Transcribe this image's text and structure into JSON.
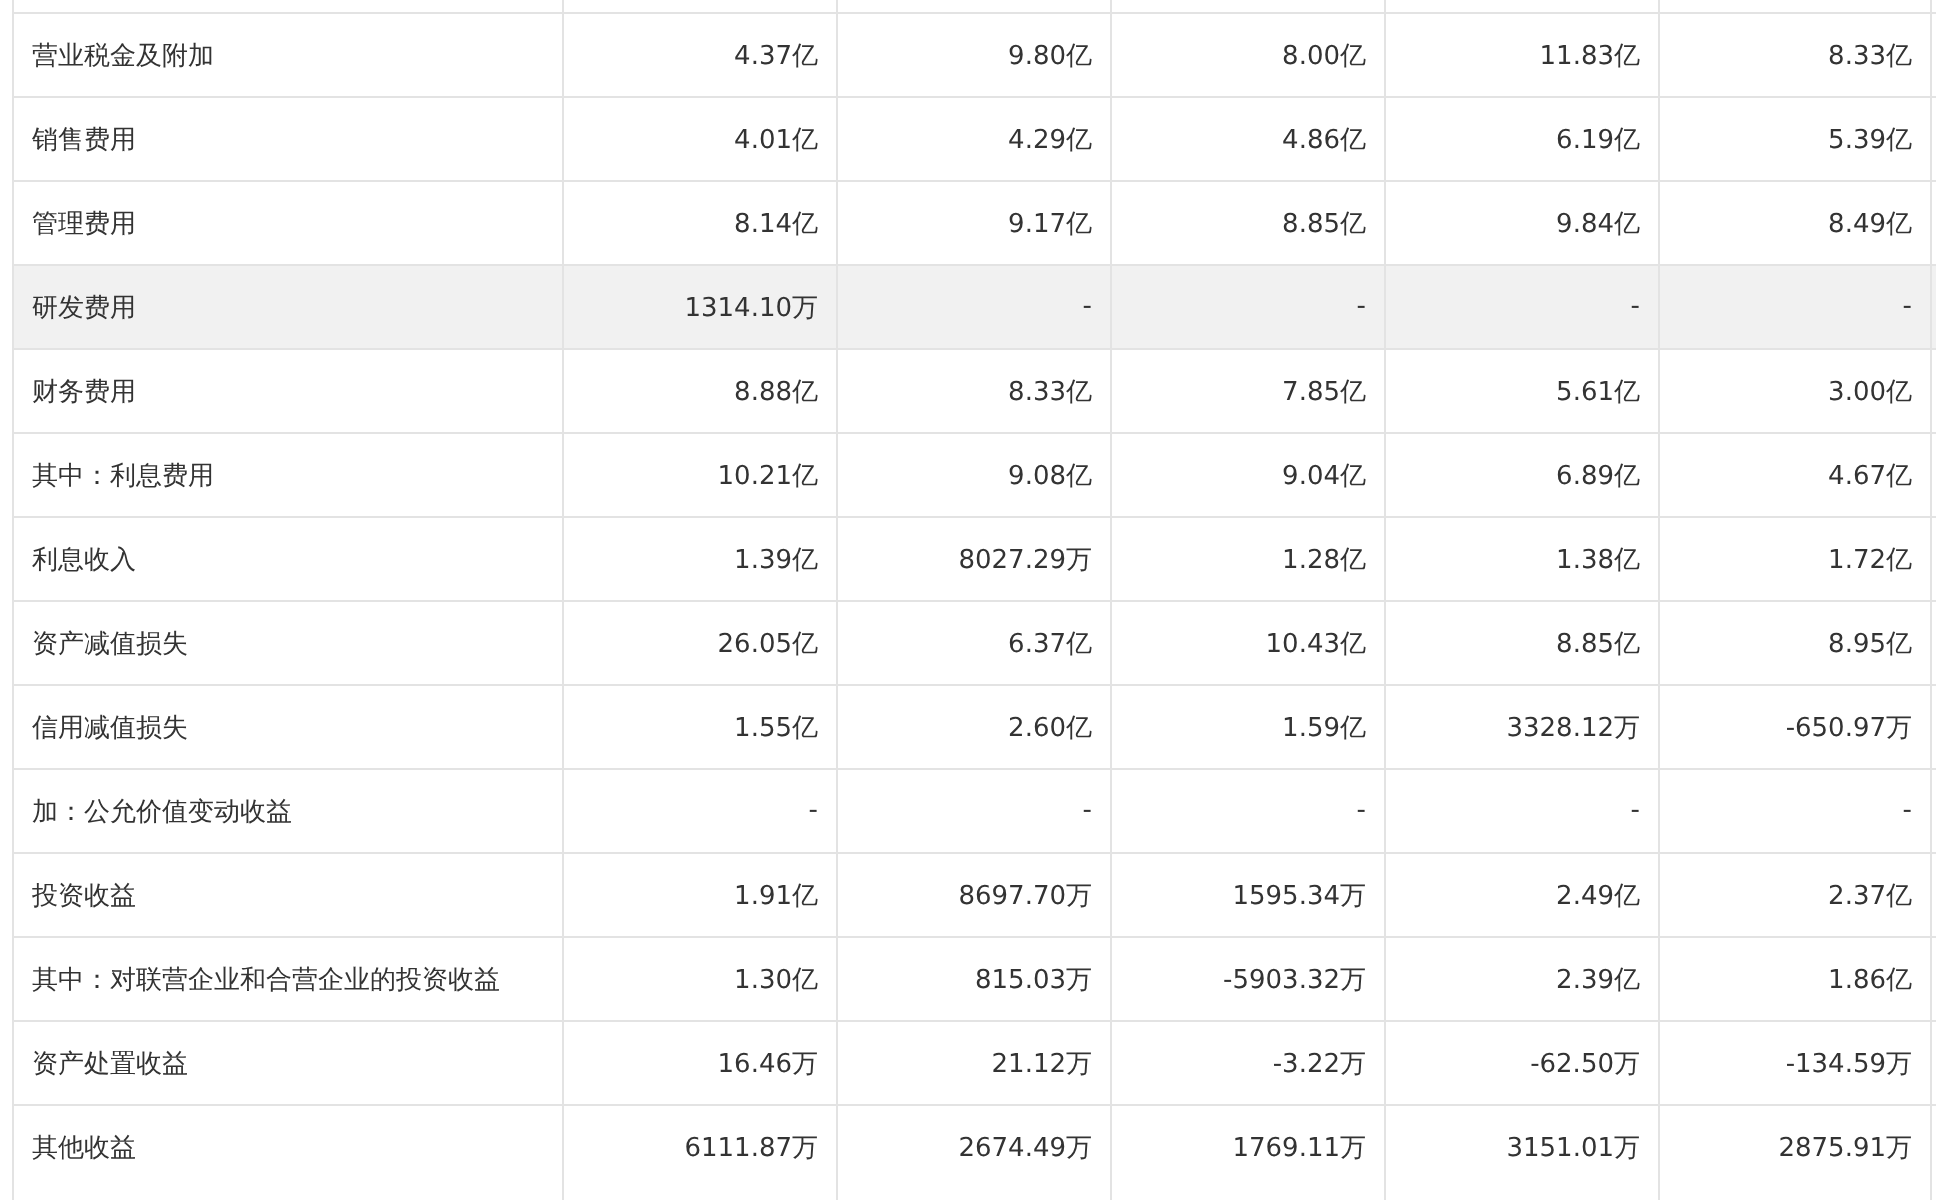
{
  "table": {
    "rows": [
      {
        "label": "营业税金及附加",
        "highlighted": false,
        "values": [
          "4.37亿",
          "9.80亿",
          "8.00亿",
          "11.83亿",
          "8.33亿"
        ]
      },
      {
        "label": "销售费用",
        "highlighted": false,
        "values": [
          "4.01亿",
          "4.29亿",
          "4.86亿",
          "6.19亿",
          "5.39亿"
        ]
      },
      {
        "label": "管理费用",
        "highlighted": false,
        "values": [
          "8.14亿",
          "9.17亿",
          "8.85亿",
          "9.84亿",
          "8.49亿"
        ]
      },
      {
        "label": "研发费用",
        "highlighted": true,
        "values": [
          "1314.10万",
          "-",
          "-",
          "-",
          "-"
        ]
      },
      {
        "label": "财务费用",
        "highlighted": false,
        "values": [
          "8.88亿",
          "8.33亿",
          "7.85亿",
          "5.61亿",
          "3.00亿"
        ]
      },
      {
        "label": "其中：利息费用",
        "highlighted": false,
        "values": [
          "10.21亿",
          "9.08亿",
          "9.04亿",
          "6.89亿",
          "4.67亿"
        ]
      },
      {
        "label": "利息收入",
        "highlighted": false,
        "values": [
          "1.39亿",
          "8027.29万",
          "1.28亿",
          "1.38亿",
          "1.72亿"
        ]
      },
      {
        "label": "资产减值损失",
        "highlighted": false,
        "values": [
          "26.05亿",
          "6.37亿",
          "10.43亿",
          "8.85亿",
          "8.95亿"
        ]
      },
      {
        "label": "信用减值损失",
        "highlighted": false,
        "values": [
          "1.55亿",
          "2.60亿",
          "1.59亿",
          "3328.12万",
          "-650.97万"
        ]
      },
      {
        "label": "加：公允价值变动收益",
        "highlighted": false,
        "values": [
          "-",
          "-",
          "-",
          "-",
          "-"
        ]
      },
      {
        "label": "投资收益",
        "highlighted": false,
        "values": [
          "1.91亿",
          "8697.70万",
          "1595.34万",
          "2.49亿",
          "2.37亿"
        ]
      },
      {
        "label": "其中：对联营企业和合营企业的投资收益",
        "highlighted": false,
        "values": [
          "1.30亿",
          "815.03万",
          "-5903.32万",
          "2.39亿",
          "1.86亿"
        ]
      },
      {
        "label": "资产处置收益",
        "highlighted": false,
        "values": [
          "16.46万",
          "21.12万",
          "-3.22万",
          "-62.50万",
          "-134.59万"
        ]
      },
      {
        "label": "其他收益",
        "highlighted": false,
        "values": [
          "6111.87万",
          "2674.49万",
          "1769.11万",
          "3151.01万",
          "2875.91万"
        ]
      }
    ]
  }
}
